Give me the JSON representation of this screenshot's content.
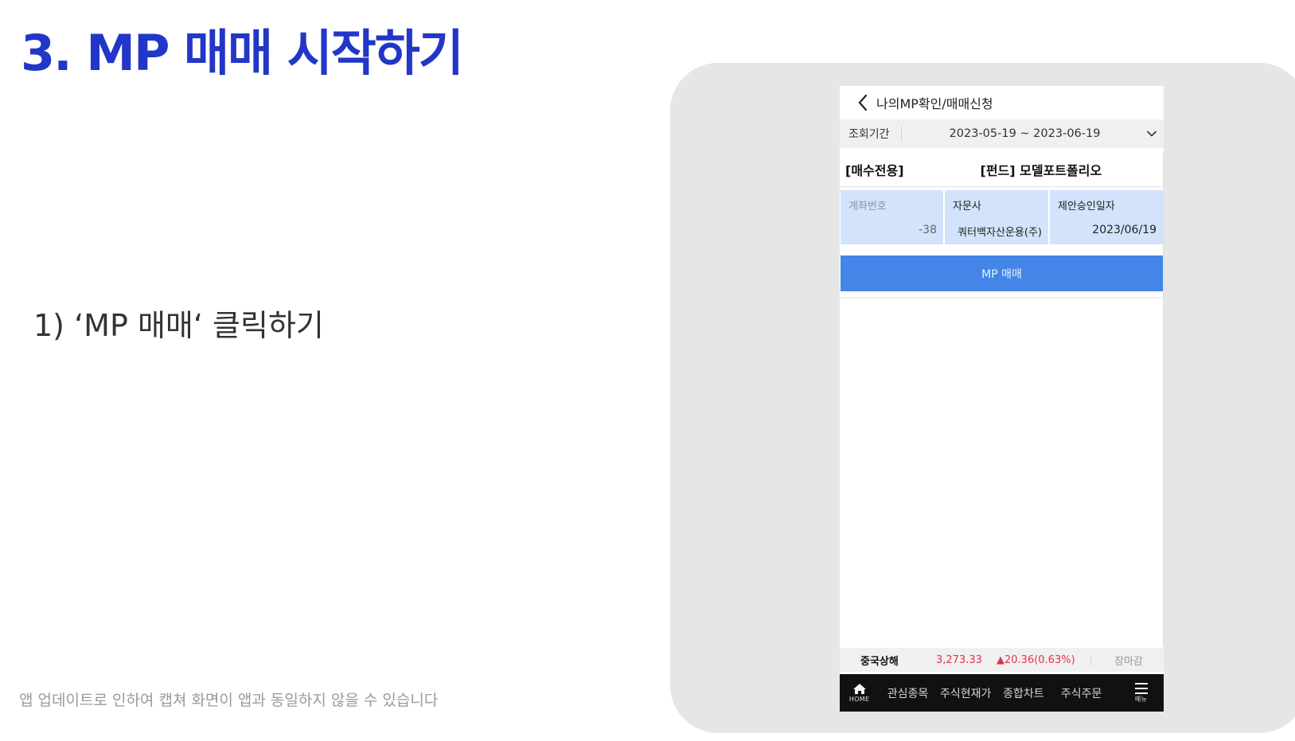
{
  "slide": {
    "title": "3. MP 매매 시작하기",
    "step": "1) ‘MP 매매‘ 클릭하기",
    "footnote": "앱 업데이트로 인하여 캡쳐 화면이 앱과 동일하지 않을 수 있습니다"
  },
  "colors": {
    "title": "#2236c7",
    "accent_button": "#4386e8",
    "info_bg": "#d2e3fb",
    "price_red": "#e0334f"
  },
  "app": {
    "header_title": "나의MP확인/매매신청",
    "period_label": "조회기간",
    "period_value": "2023-05-19 ~ 2023-06-19",
    "fund_tag": "[매수전용]",
    "fund_name": "[펀드] 모델포트폴리오",
    "info": {
      "account_label": "계좌번호",
      "account_value": "-38",
      "advisor_label": "자문사",
      "advisor_value": "쿼터백자산운용(주)",
      "date_label": "제안승인일자",
      "date_value": "2023/06/19"
    },
    "mp_button_label": "MP 매매",
    "ticker": {
      "name": "중국상해",
      "price": "3,273.33",
      "change": "▲20.36(0.63%)",
      "status": "장마감"
    },
    "nav": {
      "home_label": "HOME",
      "items": [
        "관심종목",
        "주식현재가",
        "종합차트",
        "주식주문"
      ],
      "menu_label": "메뉴"
    }
  },
  "icons": [
    "back-chevron",
    "dropdown-chevron",
    "home",
    "menu-hamburger"
  ]
}
